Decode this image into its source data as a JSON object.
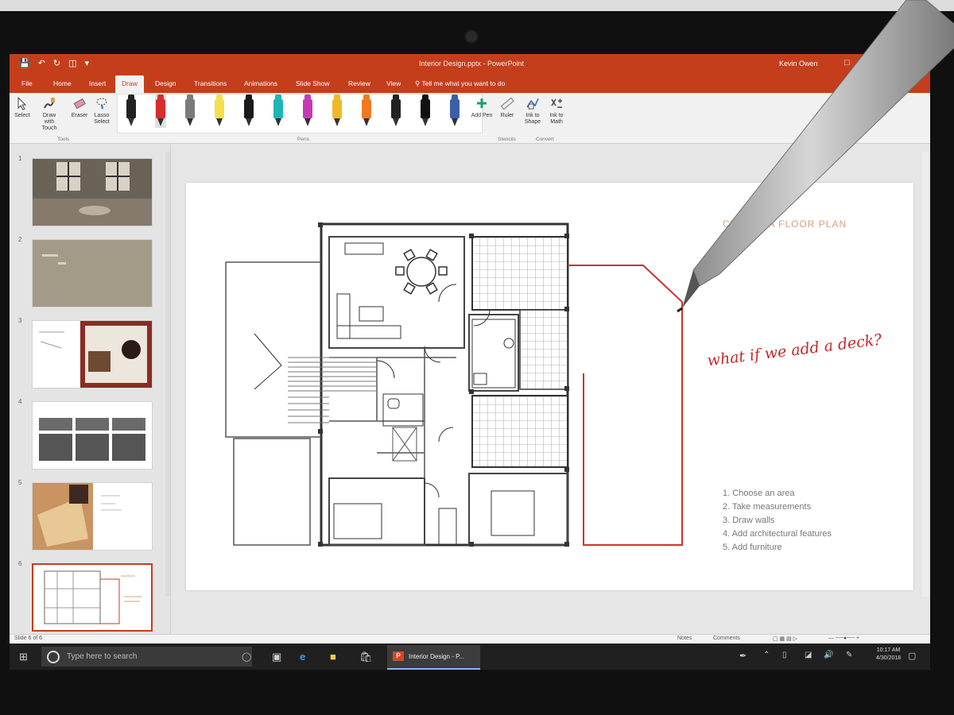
{
  "app": {
    "title": "Interior Design.pptx - PowerPoint",
    "user": "Kevin Owen",
    "quick_access": [
      "save-icon",
      "undo-icon",
      "redo-icon",
      "start-from-beginning-icon"
    ],
    "window_controls": [
      "restore-icon",
      "minimize-icon",
      "close-icon"
    ]
  },
  "ribbon": {
    "tabs": [
      "File",
      "Home",
      "Insert",
      "Draw",
      "Design",
      "Transitions",
      "Animations",
      "Slide Show",
      "Review",
      "View"
    ],
    "active_tab": "Draw",
    "tell_me": "Tell me what you want to do",
    "tools": [
      {
        "label": "Select",
        "icon": "select-icon"
      },
      {
        "label": "Draw with Touch",
        "icon": "draw-with-touch-icon"
      },
      {
        "label": "Eraser",
        "icon": "eraser-icon"
      },
      {
        "label": "Lasso Select",
        "icon": "lasso-icon"
      }
    ],
    "tools_group": "Tools",
    "pens_group": "Pens",
    "pens": [
      {
        "color": "#222222",
        "selected": false
      },
      {
        "color": "#d32f2f",
        "selected": true
      },
      {
        "color": "#7b7b7b",
        "selected": false
      },
      {
        "color": "#f4e04d",
        "selected": false
      },
      {
        "color": "#1a1a1a",
        "selected": false
      },
      {
        "color": "#1fb5b5",
        "selected": false
      },
      {
        "color": "#c43bb5",
        "selected": false
      },
      {
        "color": "#f0b92a",
        "selected": false
      },
      {
        "color": "#f07a22",
        "selected": false
      },
      {
        "color": "#222222",
        "selected": false
      },
      {
        "color": "#111111",
        "selected": false
      },
      {
        "color": "#3a5fa8",
        "selected": false
      }
    ],
    "add_pen": "Add Pen",
    "ruler": "Ruler",
    "stencils_group": "Stencils",
    "ink_to_shape": "Ink to Shape",
    "ink_to_math": "Ink to Math",
    "convert_group": "Convert"
  },
  "thumbnails": [
    {
      "num": "1",
      "style": "photo-room"
    },
    {
      "num": "2",
      "style": "tan"
    },
    {
      "num": "3",
      "style": "collage"
    },
    {
      "num": "4",
      "style": "grid"
    },
    {
      "num": "5",
      "style": "photo-desk"
    },
    {
      "num": "6",
      "style": "floor-plan"
    }
  ],
  "slide": {
    "title": "CREATE A FLOOR PLAN",
    "ink_note": "what if we add a deck?",
    "steps": [
      "1. Choose an area",
      "2. Take measurements",
      "3. Draw walls",
      "4. Add architectural features",
      "5. Add furniture"
    ]
  },
  "status": {
    "slide_info": "Slide 6 of 6",
    "notes": "Notes",
    "comments": "Comments"
  },
  "taskbar": {
    "search_placeholder": "Type here to search",
    "active_app": "Interior Design - P...",
    "time": "10:17 AM",
    "date": "4/30/2018",
    "accent": "#c43e1c"
  }
}
